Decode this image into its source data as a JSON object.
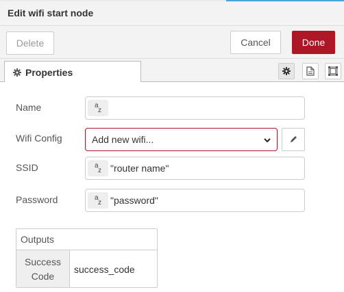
{
  "tray": {
    "title": "Edit wifi start node",
    "delete_label": "Delete",
    "cancel_label": "Cancel",
    "done_label": "Done"
  },
  "tabs": {
    "properties_label": "Properties"
  },
  "form": {
    "name": {
      "label": "Name",
      "value": ""
    },
    "wifi_config": {
      "label": "Wifi Config",
      "selected": "Add new wifi..."
    },
    "ssid": {
      "label": "SSID",
      "value": "\"router name\""
    },
    "password": {
      "label": "Password",
      "value": "\"password\""
    }
  },
  "outputs": {
    "header": "Outputs",
    "rows": [
      {
        "key_line1": "Success",
        "key_line2": "Code",
        "value": "success_code"
      }
    ]
  },
  "colors": {
    "accent": "#ad1625",
    "header_bg": "#f3f3f3",
    "type_btn_bg": "#eeeeee"
  }
}
